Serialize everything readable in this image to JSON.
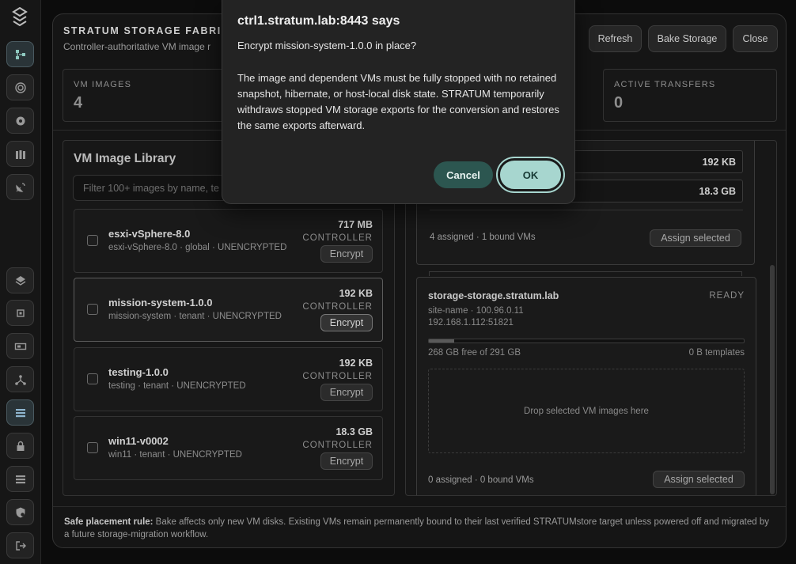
{
  "sidebar": {
    "logo_icon": "stratum-logo-icon",
    "items": [
      {
        "icon": "topology-icon",
        "active": true
      },
      {
        "icon": "target-icon",
        "active": false
      },
      {
        "icon": "settings-cog-icon",
        "active": false
      },
      {
        "icon": "bottles-icon",
        "active": false
      },
      {
        "icon": "satellite-dish-icon",
        "active": false
      },
      {
        "icon": "layers-icon",
        "active": false
      },
      {
        "icon": "chip-icon",
        "active": false
      },
      {
        "icon": "gpu-card-icon",
        "active": false
      },
      {
        "icon": "network-node-icon",
        "active": false
      },
      {
        "icon": "storage-list-icon",
        "active": true
      },
      {
        "icon": "lock-icon",
        "active": false
      },
      {
        "icon": "server-rack-icon",
        "active": false
      },
      {
        "icon": "shield-gear-icon",
        "active": false
      },
      {
        "icon": "logout-icon",
        "active": false
      }
    ]
  },
  "header": {
    "title": "STRATUM STORAGE FABRIC",
    "subtitle": "Controller-authoritative VM image r",
    "buttons": {
      "refresh": "Refresh",
      "bake": "Bake Storage",
      "close": "Close"
    }
  },
  "stats": {
    "vm_images": {
      "label": "VM IMAGES",
      "value": "4"
    },
    "active_transfers": {
      "label": "ACTIVE TRANSFERS",
      "value": "0"
    }
  },
  "library": {
    "title": "VM Image Library",
    "filter_placeholder": "Filter 100+ images by name, te",
    "images": [
      {
        "name": "esxi-vSphere-8.0",
        "meta": "esxi-vSphere-8.0 · global · UNENCRYPTED",
        "size": "717 MB",
        "location": "CONTROLLER",
        "action": "Encrypt"
      },
      {
        "name": "mission-system-1.0.0",
        "meta": "mission-system · tenant · UNENCRYPTED",
        "size": "192 KB",
        "location": "CONTROLLER",
        "action": "Encrypt"
      },
      {
        "name": "testing-1.0.0",
        "meta": "testing · tenant · UNENCRYPTED",
        "size": "192 KB",
        "location": "CONTROLLER",
        "action": "Encrypt"
      },
      {
        "name": "win11-v0002",
        "meta": "win11 · tenant · UNENCRYPTED",
        "size": "18.3 GB",
        "location": "CONTROLLER",
        "action": "Encrypt"
      }
    ]
  },
  "targets": {
    "first": {
      "rows": [
        "192 KB",
        "18.3 GB"
      ],
      "footer": "4 assigned · 1 bound VMs",
      "assign_label": "Assign selected"
    },
    "second": {
      "host": "storage-storage.stratum.lab",
      "status": "READY",
      "site": "site-name · 100.96.0.11",
      "address": "192.168.1.112:51821",
      "usage_fraction": 0.08,
      "free": "268 GB free of 291 GB",
      "templates": "0 B templates",
      "drop_text": "Drop selected VM images here",
      "footer": "0 assigned · 0 bound VMs",
      "assign_label": "Assign selected"
    }
  },
  "rule": {
    "label": "Safe placement rule:",
    "text": " Bake affects only new VM disks. Existing VMs remain permanently bound to their last verified STRATUMstore target unless powered off and migrated by a future storage-migration workflow."
  },
  "dialog": {
    "title": "ctrl1.stratum.lab:8443 says",
    "question": "Encrypt mission-system-1.0.0 in place?",
    "body": "The image and dependent VMs must be fully stopped with no retained snapshot, hibernate, or host-local disk state. STRATUM temporarily withdraws stopped VM storage exports for the conversion and restores the same exports afterward.",
    "cancel": "Cancel",
    "ok": "OK"
  }
}
